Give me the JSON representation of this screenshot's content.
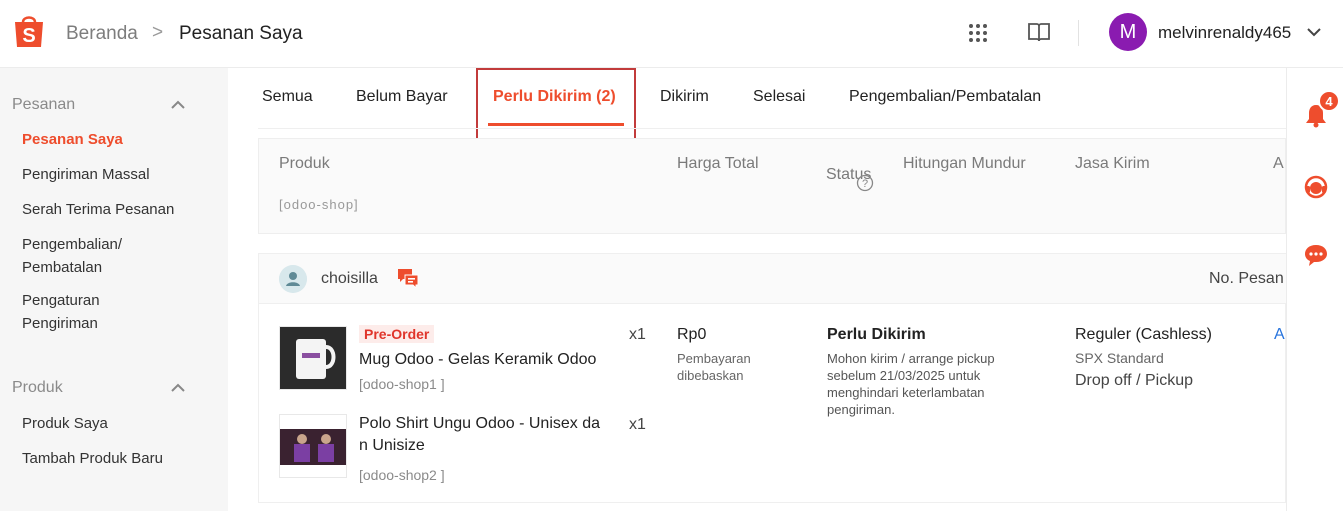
{
  "colors": {
    "accent": "#ee4d2d",
    "avatar": "#8a1bb0",
    "link": "#2673dd"
  },
  "header": {
    "logo_icon": "shopee-bag-icon",
    "breadcrumb_home": "Beranda",
    "breadcrumb_separator": ">",
    "breadcrumb_current": "Pesanan Saya",
    "avatar_letter": "M",
    "username": "melvinrenaldy465"
  },
  "sidebar": {
    "sections": [
      {
        "title": "Pesanan",
        "items": [
          "Pesanan Saya",
          "Pengiriman Massal",
          "Serah Terima Pesanan",
          "Pengembalian/ Pembatalan",
          "Pengaturan Pengiriman"
        ]
      },
      {
        "title": "Produk",
        "items": [
          "Produk Saya",
          "Tambah Produk Baru"
        ]
      }
    ],
    "active_item": "Pesanan Saya"
  },
  "tabs": [
    "Semua",
    "Belum Bayar",
    "Perlu Dikirim (2)",
    "Dikirim",
    "Selesai",
    "Pengembalian/Pembatalan"
  ],
  "active_tab": "Perlu Dikirim (2)",
  "table_headers": [
    "Produk",
    "Harga Total",
    "Status",
    "Hitungan Mundur",
    "Jasa Kirim",
    "A"
  ],
  "peek_row_text": "[odoo-shop]",
  "order": {
    "shop_name": "choisilla",
    "order_no_label": "No. Pesan",
    "items": [
      {
        "badge": "Pre-Order",
        "name": "Mug Odoo - Gelas Keramik Odoo",
        "variant": "[odoo-shop1 ]",
        "qty": "x1"
      },
      {
        "name_line1": "Polo Shirt Ungu Odoo - Unisex da",
        "name_line2": "n Unisize",
        "variant": "[odoo-shop2 ]",
        "qty": "x1"
      }
    ],
    "price": "Rp0",
    "price_note_line1": "Pembayaran",
    "price_note_line2": "dibebaskan",
    "status_title": "Perlu Dikirim",
    "status_note_lines": [
      "Mohon kirim / arrange pickup",
      "sebelum 21/03/2025 untuk",
      "menghindari keterlambatan",
      "pengiriman."
    ],
    "shipping_title": "Reguler (Cashless)",
    "shipping_sub": "SPX Standard",
    "shipping_mode": "Drop off / Pickup",
    "action_peek": "A"
  },
  "rail": {
    "notification_count": "4"
  }
}
